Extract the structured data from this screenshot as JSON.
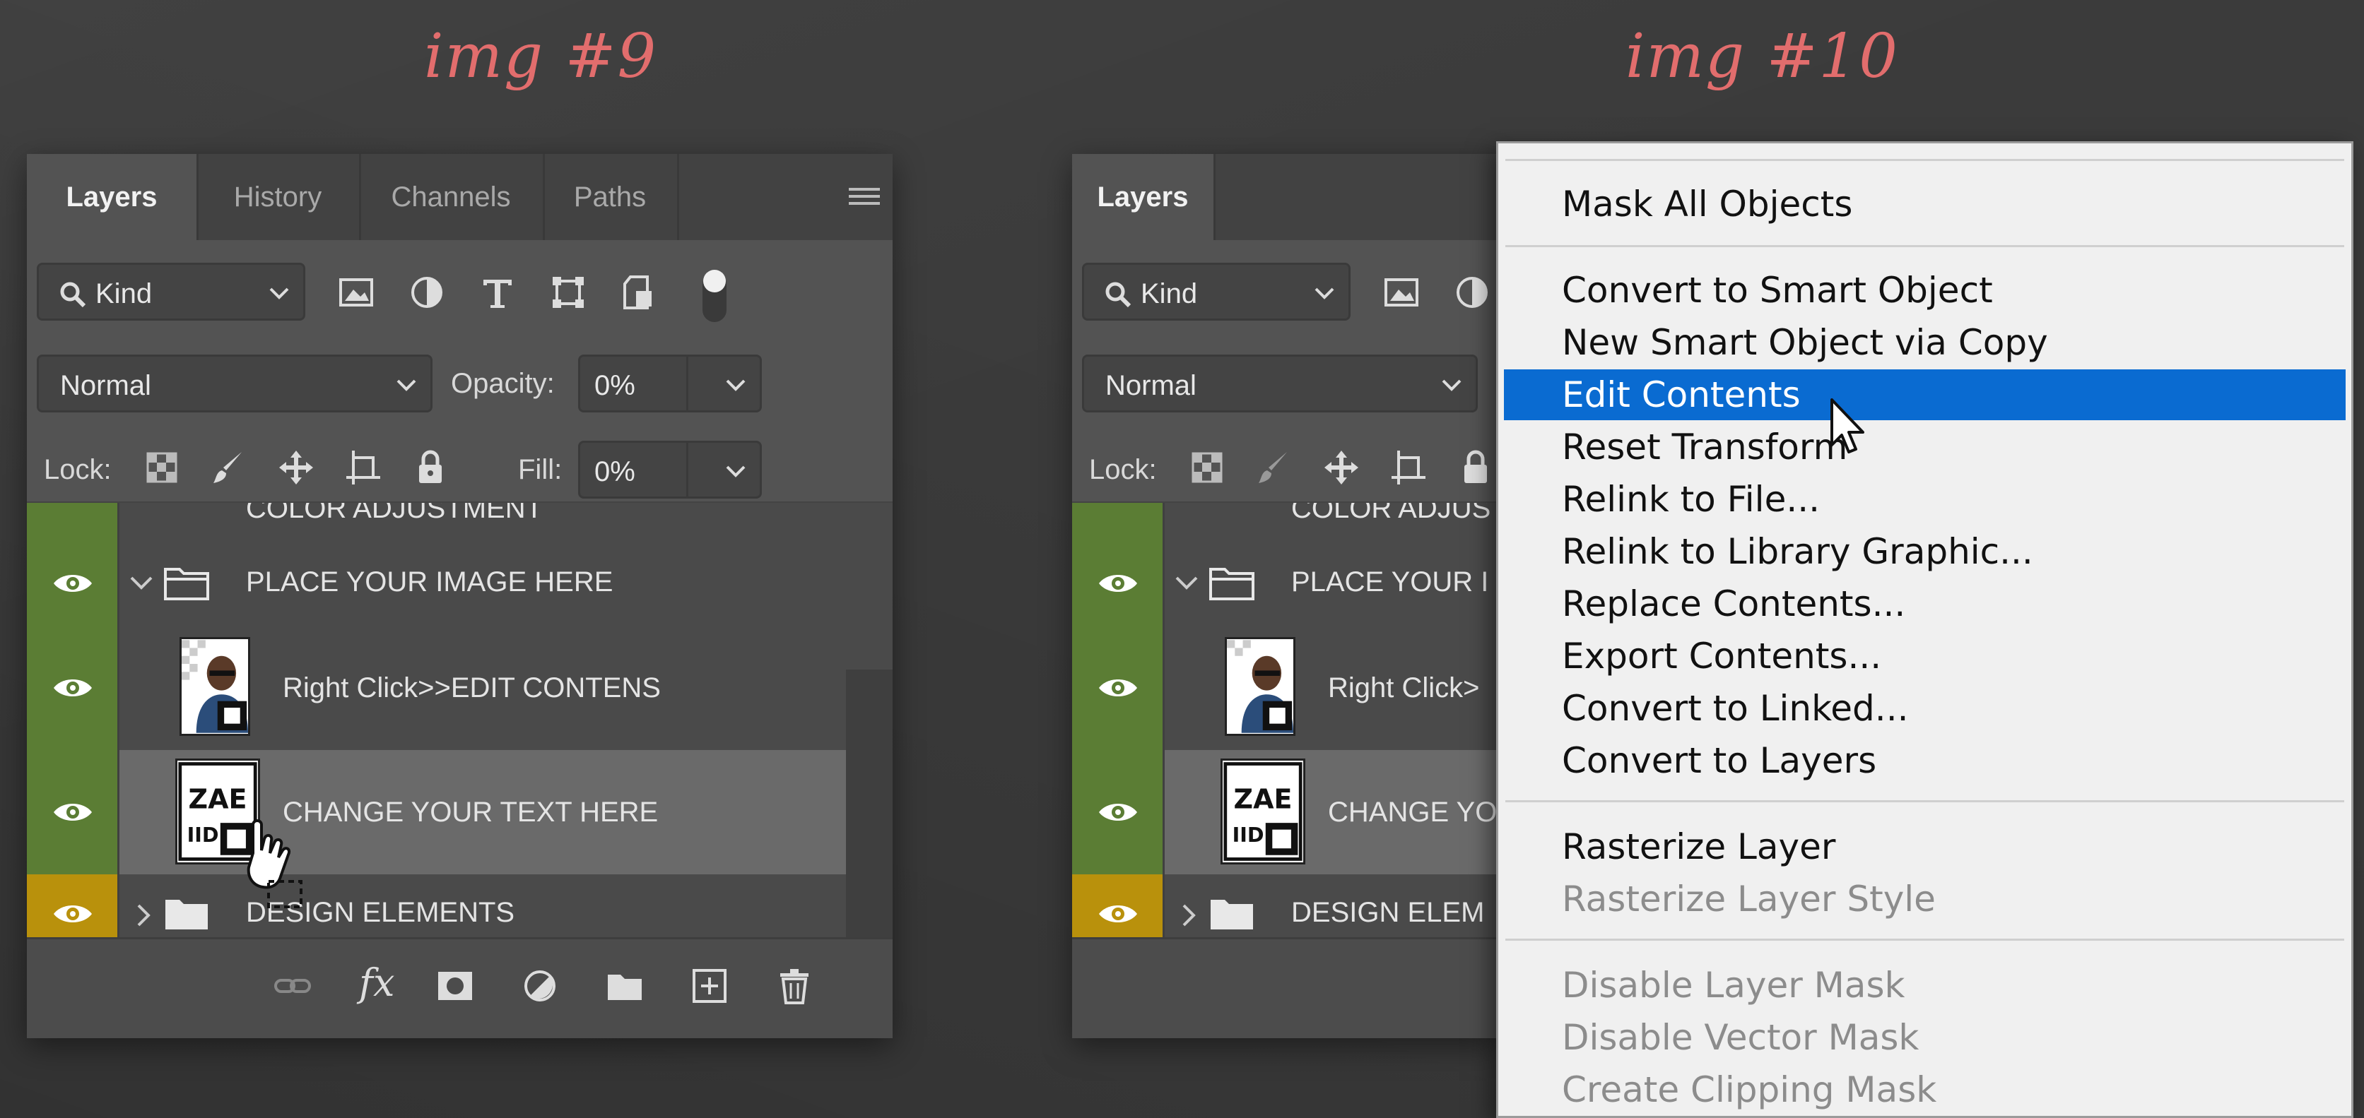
{
  "captions": {
    "left": "img #9",
    "right": "img #10"
  },
  "panel": {
    "tabs": [
      "Layers",
      "History",
      "Channels",
      "Paths"
    ],
    "filter": {
      "kind_label": "Kind"
    },
    "blend_mode": "Normal",
    "opacity_label": "Opacity:",
    "opacity_value": "0%",
    "lock_label": "Lock:",
    "fill_label": "Fill:",
    "fill_value": "0%",
    "layers": [
      {
        "name": "COLOR ADJUSTMENT",
        "type": "group",
        "visible": true
      },
      {
        "name": "PLACE YOUR IMAGE HERE",
        "type": "group",
        "expanded": true,
        "visible": true
      },
      {
        "name": "Right Click>>EDIT CONTENS",
        "type": "smart-object",
        "visible": true
      },
      {
        "name": "CHANGE YOUR TEXT HERE",
        "type": "smart-object",
        "visible": true,
        "selected": true
      },
      {
        "name": "DESIGN ELEMENTS",
        "type": "group",
        "visible": true,
        "color": "#b9910c"
      }
    ],
    "right_panel": {
      "tab": "Layers",
      "kind_label": "Kind",
      "blend_mode": "Normal",
      "lock_label": "Lock:",
      "layer_names_truncated": [
        "COLOR ADJUS",
        "PLACE YOUR I",
        "Right Click>",
        "CHANGE YO",
        "DESIGN ELEM"
      ]
    }
  },
  "context_menu": {
    "items": [
      {
        "label": "Mask All Objects",
        "enabled": true
      },
      {
        "label": "Convert to Smart Object",
        "enabled": true
      },
      {
        "label": "New Smart Object via Copy",
        "enabled": true
      },
      {
        "label": "Edit Contents",
        "enabled": true,
        "highlighted": true
      },
      {
        "label": "Reset Transform",
        "enabled": true
      },
      {
        "label": "Relink to File...",
        "enabled": true
      },
      {
        "label": "Relink to Library Graphic...",
        "enabled": true
      },
      {
        "label": "Replace Contents...",
        "enabled": true
      },
      {
        "label": "Export Contents...",
        "enabled": true
      },
      {
        "label": "Convert to Linked...",
        "enabled": true
      },
      {
        "label": "Convert to Layers",
        "enabled": true
      },
      {
        "label": "Rasterize Layer",
        "enabled": true
      },
      {
        "label": "Rasterize Layer Style",
        "enabled": false
      },
      {
        "label": "Disable Layer Mask",
        "enabled": false
      },
      {
        "label": "Disable Vector Mask",
        "enabled": false
      },
      {
        "label": "Create Clipping Mask",
        "enabled": false
      }
    ]
  },
  "colors": {
    "eye_green": "#5b7d34",
    "eye_gold": "#b9910c",
    "highlight": "#0a6bd1",
    "caption": "#e26d6d"
  }
}
